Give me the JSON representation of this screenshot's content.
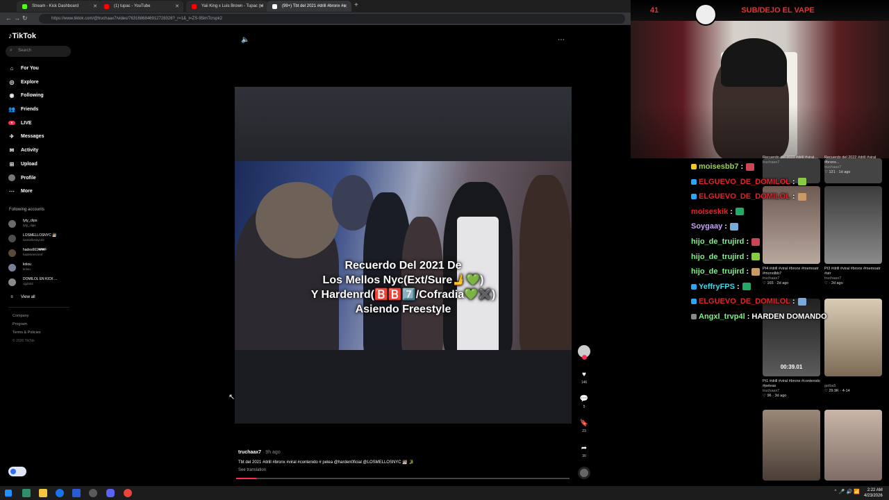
{
  "browser": {
    "tabs": [
      {
        "title": "Stream - Kick Dashboard",
        "favicon_color": "#53fc18"
      },
      {
        "title": "(1) tupac - YouTube",
        "favicon_color": "#ff0000"
      },
      {
        "title": "Yaii King x Luis Brown - Tupac (vi",
        "favicon_color": "#ff0000"
      },
      {
        "title": "(99+) Tbt del 2021 #drill #bronx #c",
        "favicon_color": "#ffffff"
      }
    ],
    "url": "https://www.tiktok.com/@truchaax7/video/7631686846912728328?_r=1&_t=ZS-95imTcrspk2"
  },
  "tiktok": {
    "logo": "TikTok",
    "search_placeholder": "Search",
    "nav": [
      {
        "label": "For You",
        "icon": "home-icon"
      },
      {
        "label": "Explore",
        "icon": "compass-icon"
      },
      {
        "label": "Following",
        "icon": "following-icon"
      },
      {
        "label": "Friends",
        "icon": "friends-icon"
      },
      {
        "label": "LIVE",
        "icon": "live-icon"
      },
      {
        "label": "Messages",
        "icon": "messages-icon"
      },
      {
        "label": "Activity",
        "icon": "activity-icon"
      },
      {
        "label": "Upload",
        "icon": "upload-icon"
      },
      {
        "label": "Profile",
        "icon": "profile-icon"
      },
      {
        "label": "More",
        "icon": "more-icon"
      }
    ],
    "following_title": "Following accounts",
    "accounts": [
      {
        "name": "tyty_clips",
        "handle": "tyty_clips"
      },
      {
        "name": "LOSMELLOSNYC 🧖🏽",
        "handle": "losmellosnyc22"
      },
      {
        "name": "hades661₩₩F",
        "handle": "hadeseesnnnf"
      },
      {
        "name": "kriiou",
        "handle": "kriiou"
      },
      {
        "name": "DOMILOL EN KICK ...",
        "handle": "ogdolol"
      }
    ],
    "view_all": "View all",
    "footer": [
      "Company",
      "Program",
      "Terms & Policies",
      "© 2026 TikTok"
    ],
    "video": {
      "caption_lines": [
        "Recuerdo Del 2021 De",
        "Los Mellos Nyc(Ext/Sure🫸💚)",
        "Y Hardenrd(🅱️🅱️7️⃣/Cofradia💚✖️)",
        "Asiendo Freestyle"
      ],
      "author": "truchaax7",
      "time": "· 9h ago",
      "description": "Tbt del 2021 #drill #bronx #viral #contenido # pelea @harden0ficial @LOSMELLOSNYC 🧖🏽 🐊",
      "see_translation": "See translation",
      "likes": "146",
      "comments": "5",
      "saves": "23",
      "shares": "30",
      "progress_fraction": 0.06
    }
  },
  "stream": {
    "viewer_count": "41",
    "banner_text": "SUB/DEJO EL VAPE",
    "chat": [
      {
        "user": "moisesbb7",
        "color": "#9bd14a",
        "badge": "#f3c623",
        "message": ""
      },
      {
        "user": "ELGUEVO_DE_DOMILOL",
        "color": "#e8212a",
        "badge": "#2aa6f5",
        "message": ""
      },
      {
        "user": "ELGUEVO_DE_DOMILOL",
        "color": "#e8212a",
        "badge": "#2aa6f5",
        "message": ""
      },
      {
        "user": "moiseskik",
        "color": "#e8212a",
        "badge": "",
        "message": ""
      },
      {
        "user": "Soygaay",
        "color": "#c9a3f5",
        "badge": "",
        "message": ""
      },
      {
        "user": "hijo_de_trujird",
        "color": "#7ef08a",
        "badge": "",
        "message": ""
      },
      {
        "user": "hijo_de_trujird",
        "color": "#7ef08a",
        "badge": "",
        "message": ""
      },
      {
        "user": "hijo_de_trujird",
        "color": "#7ef08a",
        "badge": "",
        "message": ""
      },
      {
        "user": "YeffryFPS",
        "color": "#3cd9e8",
        "badge": "#2aa6f5",
        "message": ""
      },
      {
        "user": "ELGUEVO_DE_DOMILOL",
        "color": "#e8212a",
        "badge": "#2aa6f5",
        "message": ""
      },
      {
        "user": "Angxl_trvp4l",
        "color": "#7ef08a",
        "badge": "#888888",
        "message": "HARDEN DOMANDO"
      }
    ],
    "grid": [
      {
        "title": "Recuerdo del 2023 #drill #viral...",
        "user": "truchaax7",
        "stats": "",
        "time": ""
      },
      {
        "title": "Recuerdo del 2022 #drill #viral #bronx...",
        "user": "truchaax7",
        "stats": "121",
        "time": "· 1d ago"
      },
      {
        "title": "Pt4 #drill #viral #bronx #memoatr #monolbb7",
        "user": "truchaax7",
        "stats": "165",
        "time": "· 2d ago"
      },
      {
        "title": "Pt3 #drill #viral #bronx #memoatr #atr",
        "user": "truchaax7",
        "stats": "",
        "time": "· 2d ago"
      },
      {
        "title": "Pt1 #drill #viral #bronx #contenido #peleas",
        "user": "truchaax7",
        "stats": "96",
        "time": "· 3d ago"
      },
      {
        "title": "",
        "user": "gelba5",
        "stats": "29.9K",
        "time": "· 4-14"
      }
    ],
    "thumb_timer": "00:39.01"
  },
  "taskbar": {
    "time": "2:22 AM",
    "date": "4/23/2026"
  }
}
